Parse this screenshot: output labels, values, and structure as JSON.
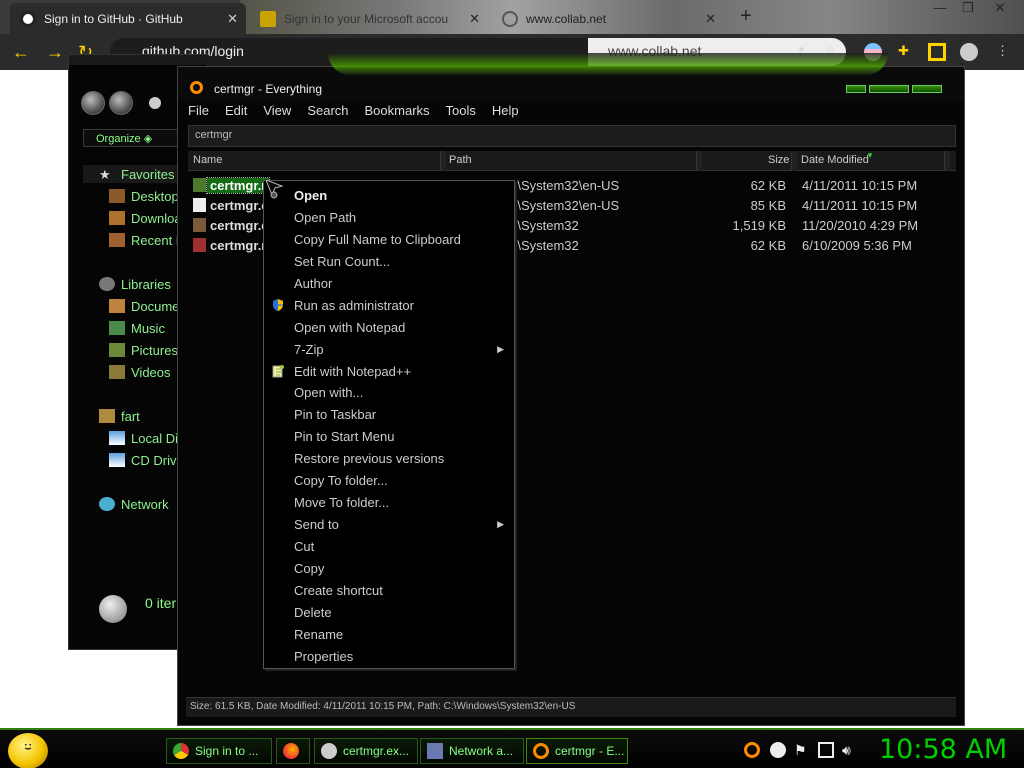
{
  "browser": {
    "tabs": [
      {
        "label": "Sign in to GitHub · GitHub",
        "active": true
      },
      {
        "label": "Sign in to your Microsoft accou",
        "active": false
      },
      {
        "label": "www.collab.net",
        "active": false
      }
    ],
    "new_tab": "+",
    "address": "github.com/login",
    "address_right": "www.collab.net"
  },
  "explorer": {
    "organize_label": "Organize",
    "favorites_label": "Favorites",
    "favorites": [
      "Desktop",
      "Downloa",
      "Recent P"
    ],
    "libraries_label": "Libraries",
    "libraries": [
      "Docume",
      "Music",
      "Pictures",
      "Videos"
    ],
    "computer_label": "fart",
    "computer_items": [
      "Local Di",
      "CD Drive"
    ],
    "network_label": "Network",
    "status": "0 iter"
  },
  "everything": {
    "title": "certmgr - Everything",
    "menu": [
      "File",
      "Edit",
      "View",
      "Search",
      "Bookmarks",
      "Tools",
      "Help"
    ],
    "search_value": "certmgr",
    "columns": {
      "name": "Name",
      "path": "Path",
      "size": "Size",
      "date": "Date Modified"
    },
    "rows": [
      {
        "name": "certmgr.r",
        "path": "C:\\Windows\\System32\\en-US",
        "size": "62 KB",
        "date": "4/11/2011 10:15 PM",
        "selected": true
      },
      {
        "name": "certmgr.e",
        "path": "C:\\Windows\\System32\\en-US",
        "size": "85 KB",
        "date": "4/11/2011 10:15 PM",
        "selected": false
      },
      {
        "name": "certmgr.e",
        "path": "C:\\Windows\\System32",
        "size": "1,519 KB",
        "date": "11/20/2010 4:29 PM",
        "selected": false
      },
      {
        "name": "certmgr.r",
        "path": "C:\\Windows\\System32",
        "size": "62 KB",
        "date": "6/10/2009 5:36 PM",
        "selected": false
      }
    ],
    "status": "Size: 61.5 KB, Date Modified: 4/11/2011 10:15 PM, Path: C:\\Windows\\System32\\en-US"
  },
  "context_menu": {
    "items": [
      {
        "label": "Open",
        "bold": true
      },
      {
        "label": "Open Path"
      },
      {
        "label": "Copy Full Name to Clipboard"
      },
      {
        "label": "Set Run Count..."
      },
      {
        "label": "Author"
      },
      {
        "label": "Run as administrator",
        "icon": "shield-icon"
      },
      {
        "label": "Open with Notepad"
      },
      {
        "label": "7-Zip",
        "submenu": true
      },
      {
        "label": "Edit with Notepad++",
        "icon": "notepad-plus-plus-icon"
      },
      {
        "label": "Open with..."
      },
      {
        "label": "Pin to Taskbar"
      },
      {
        "label": "Pin to Start Menu"
      },
      {
        "label": "Restore previous versions"
      },
      {
        "label": "Copy To folder..."
      },
      {
        "label": "Move To folder..."
      },
      {
        "label": "Send to",
        "submenu": true
      },
      {
        "label": "Cut"
      },
      {
        "label": "Copy"
      },
      {
        "label": "Create shortcut"
      },
      {
        "label": "Delete"
      },
      {
        "label": "Rename"
      },
      {
        "label": "Properties"
      }
    ]
  },
  "taskbar": {
    "tasks": [
      {
        "label": "Sign in to ...",
        "icon": "chrome-icon"
      },
      {
        "label": "",
        "icon": "firefox-icon"
      },
      {
        "label": "certmgr.ex...",
        "icon": "certmgr-icon"
      },
      {
        "label": "Network a...",
        "icon": "network-icon"
      },
      {
        "label": "certmgr - E...",
        "icon": "everything-icon"
      }
    ],
    "clock": "10:58 AM"
  },
  "colors": {
    "accent_green": "#2f7f0f",
    "text_green": "#8ff08f",
    "clock_green": "#00d000",
    "chrome_accent": "#ffd200"
  }
}
